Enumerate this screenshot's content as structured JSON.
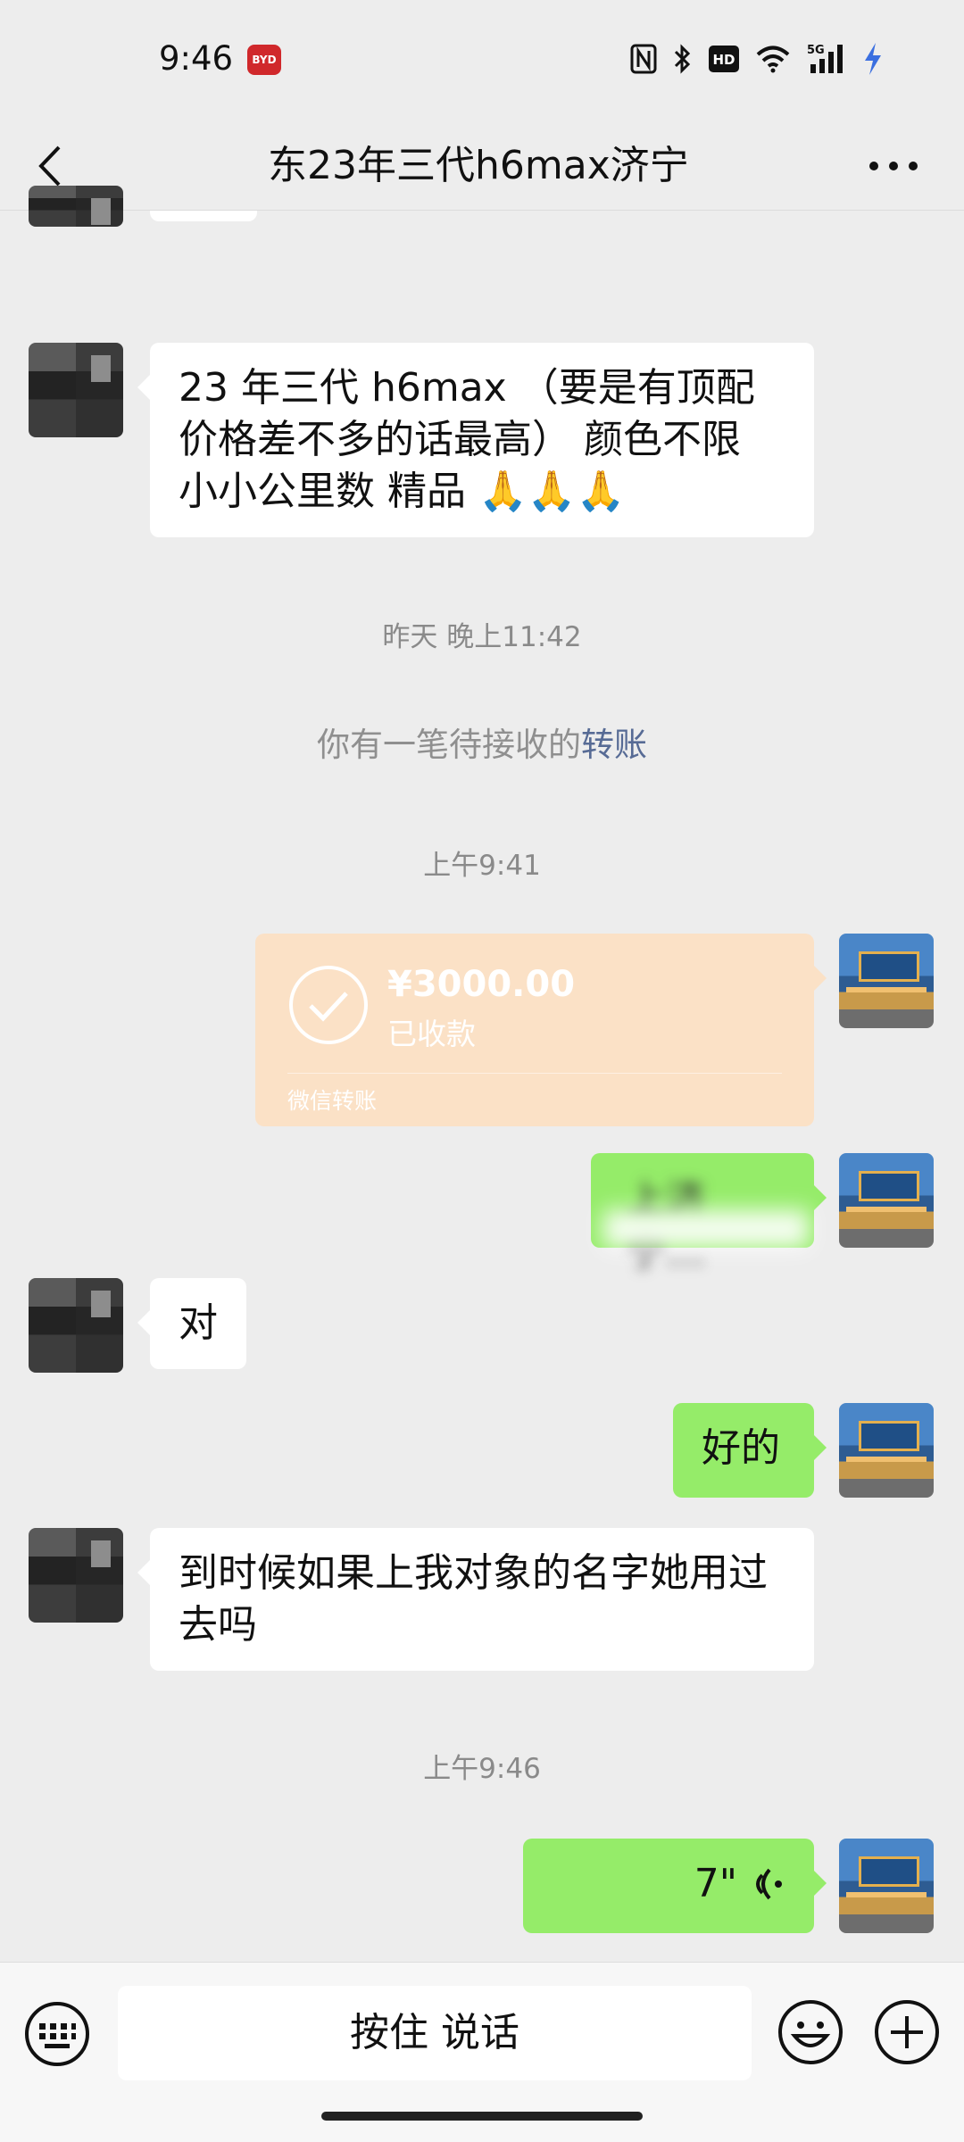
{
  "status_bar": {
    "time": "9:46",
    "app_badge": "BYD",
    "icons": [
      "nfc-icon",
      "bluetooth-icon",
      "hd-icon",
      "wifi-icon",
      "signal-5g-icon",
      "charging-icon"
    ]
  },
  "nav": {
    "title": "东23年三代h6max济宁"
  },
  "messages": {
    "peer_1": "23 年三代 h6max （要是有顶配价格差不多的话最高） 颜色不限 小小公里数 精品 🙏🙏🙏",
    "time_1": "昨天 晚上11:42",
    "system_note_prefix": "你有一笔待接收的",
    "system_note_link": "转账",
    "time_2": "上午9:41",
    "transfer": {
      "amount": "¥3000.00",
      "status": "已收款",
      "label": "微信转账"
    },
    "self_1": "上济宁…",
    "peer_2": "对",
    "self_2": "好的",
    "peer_3": "到时候如果上我对象的名字她用过去吗",
    "time_3": "上午9:46",
    "voice_duration": "7\""
  },
  "input_bar": {
    "hold_to_talk": "按住 说话"
  },
  "colors": {
    "background": "#ededed",
    "green_bubble": "#95ec69",
    "transfer_card": "#fbe1c6",
    "link": "#576b95"
  }
}
